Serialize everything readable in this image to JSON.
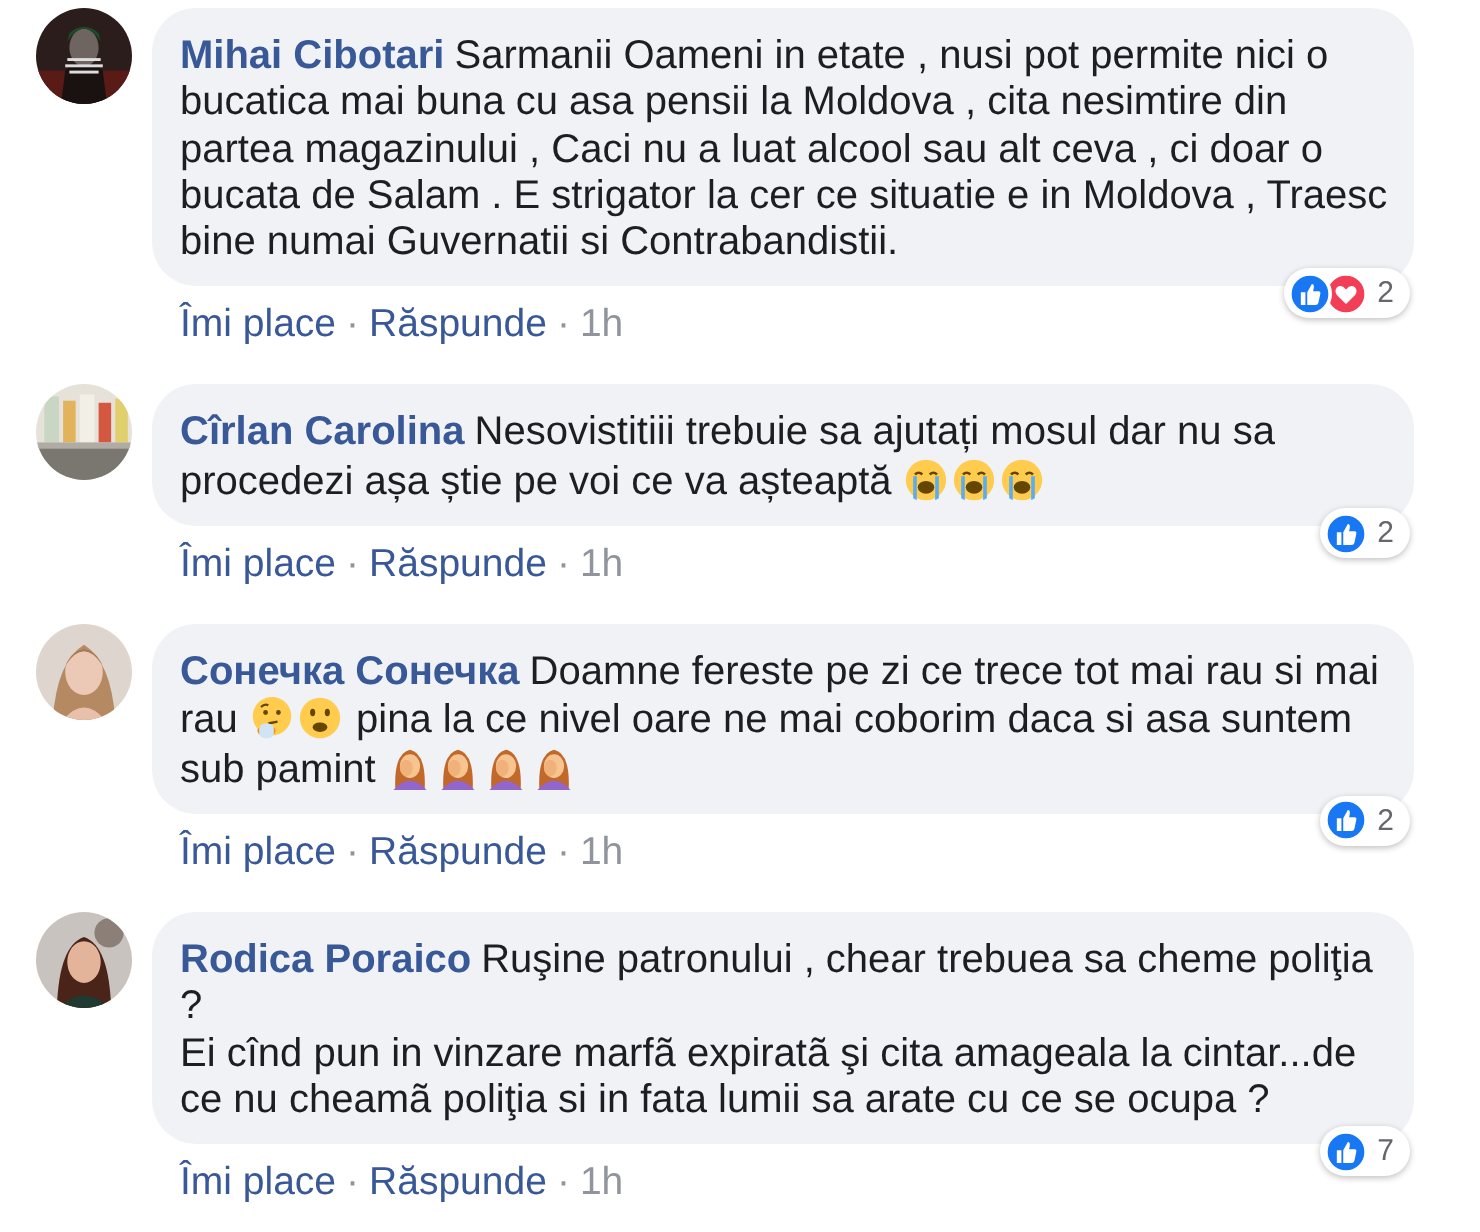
{
  "comments": [
    {
      "author": "Mihai Cibotari",
      "avatar": {
        "kind": "picture"
      },
      "body": [
        {
          "kind": "text",
          "text": "Sarmanii Oameni in etate , nusi pot permite nici o bucatica mai buna cu asa pensii la Moldova , cita nesimtire din partea magazinului , Caci nu a luat alcool sau alt ceva , ci doar o bucata de Salam . E strigator la cer ce situatie e in Moldova , Traesc bine numai Guvernatii si Contrabandistii."
        }
      ],
      "reactions": {
        "icons": [
          {
            "kind": "like"
          },
          {
            "kind": "love"
          }
        ],
        "count": "2"
      },
      "actions": [
        {
          "kind": "link",
          "text": "Îmi place"
        },
        {
          "kind": "separator",
          "text": "·"
        },
        {
          "kind": "link",
          "text": "Răspunde"
        },
        {
          "kind": "separator",
          "text": "·"
        },
        {
          "kind": "time",
          "text": "1h"
        }
      ]
    },
    {
      "author": "Cîrlan Carolina",
      "avatar": {
        "kind": "picture"
      },
      "body": [
        {
          "kind": "text",
          "text": "Nesovistitiii trebuie sa ajutați mosul dar nu sa procedezi așa știe pe voi ce va așteaptă "
        },
        {
          "kind": "crying"
        },
        {
          "kind": "crying"
        },
        {
          "kind": "crying"
        }
      ],
      "reactions": {
        "icons": [
          {
            "kind": "like"
          }
        ],
        "count": "2"
      },
      "actions": [
        {
          "kind": "link",
          "text": "Îmi place"
        },
        {
          "kind": "separator",
          "text": "·"
        },
        {
          "kind": "link",
          "text": "Răspunde"
        },
        {
          "kind": "separator",
          "text": "·"
        },
        {
          "kind": "time",
          "text": "1h"
        }
      ]
    },
    {
      "author": "Сонечка Сонечка",
      "avatar": {
        "kind": "picture"
      },
      "body": [
        {
          "kind": "text",
          "text": "Doamne fereste pe zi ce trece tot mai rau si mai rau "
        },
        {
          "kind": "thinking"
        },
        {
          "kind": "frowning"
        },
        {
          "kind": "text",
          "text": " pina la ce nivel oare ne mai coborim daca si asa suntem sub pamint "
        },
        {
          "kind": "facepalm"
        },
        {
          "kind": "facepalm"
        },
        {
          "kind": "facepalm"
        },
        {
          "kind": "facepalm"
        }
      ],
      "reactions": {
        "icons": [
          {
            "kind": "like"
          }
        ],
        "count": "2"
      },
      "actions": [
        {
          "kind": "link",
          "text": "Îmi place"
        },
        {
          "kind": "separator",
          "text": "·"
        },
        {
          "kind": "link",
          "text": "Răspunde"
        },
        {
          "kind": "separator",
          "text": "·"
        },
        {
          "kind": "time",
          "text": "1h"
        }
      ]
    },
    {
      "author": "Rodica Poraico",
      "avatar": {
        "kind": "picture"
      },
      "body": [
        {
          "kind": "text",
          "text": "Ruşine patronului , chear trebuea sa cheme poliţia ?\nEi cînd pun in vinzare marfã expiratã şi cita amageala la cintar...de ce nu cheamã poliţia si in fata lumii sa arate cu ce se ocupa ?"
        }
      ],
      "reactions": {
        "icons": [
          {
            "kind": "like"
          }
        ],
        "count": "7"
      },
      "actions": [
        {
          "kind": "link",
          "text": "Îmi place"
        },
        {
          "kind": "separator",
          "text": "·"
        },
        {
          "kind": "link",
          "text": "Răspunde"
        },
        {
          "kind": "separator",
          "text": "·"
        },
        {
          "kind": "time",
          "text": "1h"
        }
      ]
    }
  ]
}
